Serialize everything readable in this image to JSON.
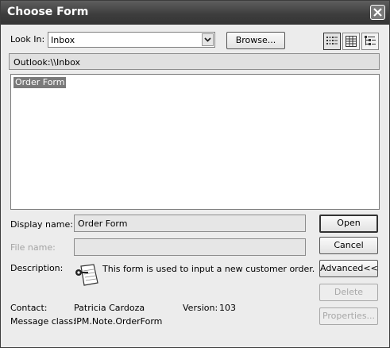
{
  "window": {
    "title": "Choose Form"
  },
  "look_in": {
    "label": "Look In:",
    "value": "Inbox"
  },
  "browse_button": "Browse...",
  "view_buttons": [
    {
      "icon": "list-view-icon",
      "active": true
    },
    {
      "icon": "details-view-icon",
      "active": false
    },
    {
      "icon": "tree-view-icon",
      "active": false
    }
  ],
  "path": "Outlook:\\\\Inbox",
  "forms": [
    {
      "label": "Order Form",
      "selected": true
    }
  ],
  "display_name": {
    "label": "Display name:",
    "value": "Order Form"
  },
  "file_name": {
    "label": "File name:",
    "value": ""
  },
  "description": {
    "label": "Description:",
    "icon": "form-icon",
    "text": "This form is used to input a new customer order."
  },
  "contact": {
    "label": "Contact:",
    "value": "Patricia Cardoza"
  },
  "version": {
    "label": "Version:",
    "value": "103"
  },
  "message_class": {
    "label": "Message class:",
    "value": "IPM.Note.OrderForm"
  },
  "buttons": {
    "open": "Open",
    "cancel": "Cancel",
    "advanced": "Advanced<<",
    "delete": "Delete",
    "properties": "Properties..."
  }
}
